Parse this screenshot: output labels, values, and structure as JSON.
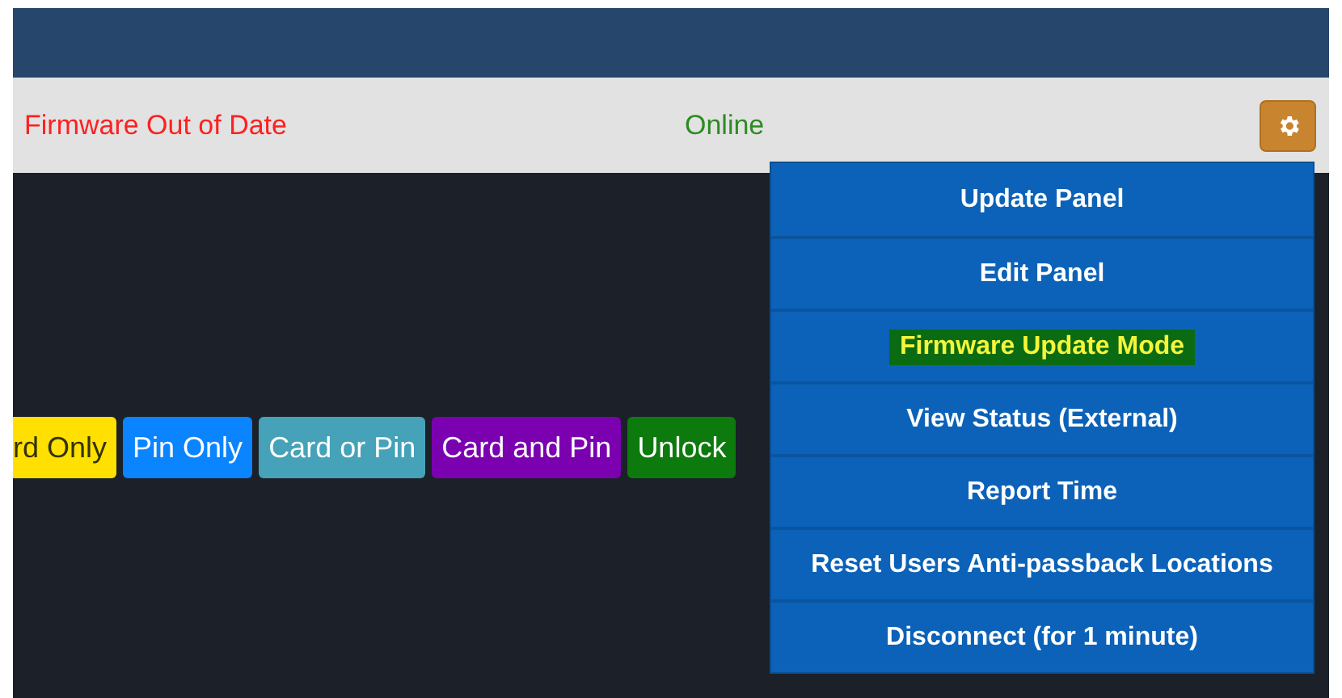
{
  "panel_row": {
    "firmware_status": "Firmware Out of Date",
    "connection_status": "Online"
  },
  "mode_badges": [
    {
      "label": "rd Only",
      "color": "#ffe000"
    },
    {
      "label": "Pin Only",
      "color": "#0a84ff"
    },
    {
      "label": "Card or Pin",
      "color": "#45a2b8"
    },
    {
      "label": "Card and Pin",
      "color": "#7a00b0"
    },
    {
      "label": "Unlock",
      "color": "#0d7a0d"
    }
  ],
  "settings_menu": {
    "items": [
      {
        "label": "Update Panel",
        "highlighted": false
      },
      {
        "label": "Edit Panel",
        "highlighted": false
      },
      {
        "label": "Firmware Update Mode",
        "highlighted": true
      },
      {
        "label": "View Status (External)",
        "highlighted": false
      },
      {
        "label": "Report Time",
        "highlighted": false
      },
      {
        "label": "Reset Users Anti-passback Locations",
        "highlighted": false
      },
      {
        "label": "Disconnect (for 1 minute)",
        "highlighted": false
      }
    ]
  }
}
